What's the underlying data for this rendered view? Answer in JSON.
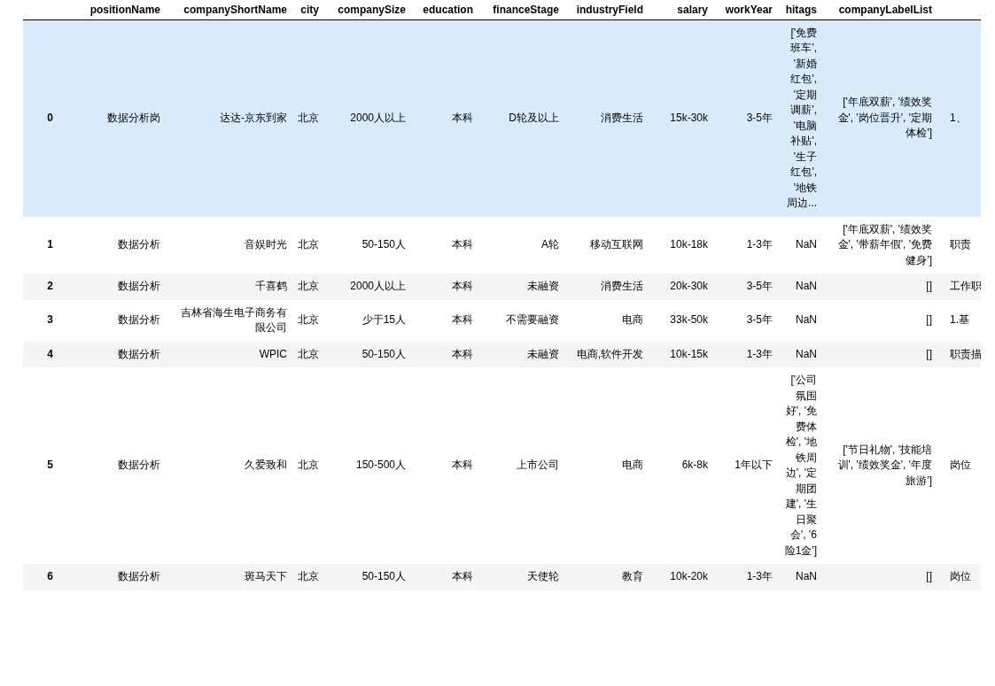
{
  "table": {
    "columns": [
      "positionName",
      "companyShortName",
      "city",
      "companySize",
      "education",
      "financeStage",
      "industryField",
      "salary",
      "workYear",
      "hitags",
      "companyLabelList"
    ],
    "rows": [
      {
        "index": "0",
        "selected": true,
        "cells": [
          "数据分析岗",
          "达达-京东到家",
          "北京",
          "2000人以上",
          "本科",
          "D轮及以上",
          "消费生活",
          "15k-30k",
          "3-5年",
          "['免费班车', '新婚红包', '定期调薪', '电脑补贴', '生子红包', '地铁周边...",
          "['年底双薪', '绩效奖金', '岗位晋升', '定期体检']",
          "1、"
        ]
      },
      {
        "index": "1",
        "selected": false,
        "cells": [
          "数据分析",
          "音娱时光",
          "北京",
          "50-150人",
          "本科",
          "A轮",
          "移动互联网",
          "10k-18k",
          "1-3年",
          "NaN",
          "['年底双薪', '绩效奖金', '带薪年假', '免费健身']",
          "职责"
        ]
      },
      {
        "index": "2",
        "selected": false,
        "cells": [
          "数据分析",
          "千喜鹤",
          "北京",
          "2000人以上",
          "本科",
          "未融资",
          "消费生活",
          "20k-30k",
          "3-5年",
          "NaN",
          "[]",
          "工作职"
        ]
      },
      {
        "index": "3",
        "selected": false,
        "cells": [
          "数据分析",
          "吉林省海生电子商务有限公司",
          "北京",
          "少于15人",
          "本科",
          "不需要融资",
          "电商",
          "33k-50k",
          "3-5年",
          "NaN",
          "[]",
          "1.基"
        ]
      },
      {
        "index": "4",
        "selected": false,
        "cells": [
          "数据分析",
          "WPIC",
          "北京",
          "50-150人",
          "本科",
          "未融资",
          "电商,软件开发",
          "10k-15k",
          "1-3年",
          "NaN",
          "[]",
          "职责描"
        ]
      },
      {
        "index": "5",
        "selected": false,
        "cells": [
          "数据分析",
          "久爱致和",
          "北京",
          "150-500人",
          "本科",
          "上市公司",
          "电商",
          "6k-8k",
          "1年以下",
          "['公司氛围好', '免费体检', '地铁周边', '定期团建', '生日聚会', '6险1金']",
          "['节日礼物', '技能培训', '绩效奖金', '年度旅游']",
          "岗位"
        ]
      },
      {
        "index": "6",
        "selected": false,
        "cells": [
          "数据分析",
          "斑马天下",
          "北京",
          "50-150人",
          "本科",
          "天使轮",
          "教育",
          "10k-20k",
          "1-3年",
          "NaN",
          "[]",
          "岗位"
        ]
      }
    ]
  }
}
